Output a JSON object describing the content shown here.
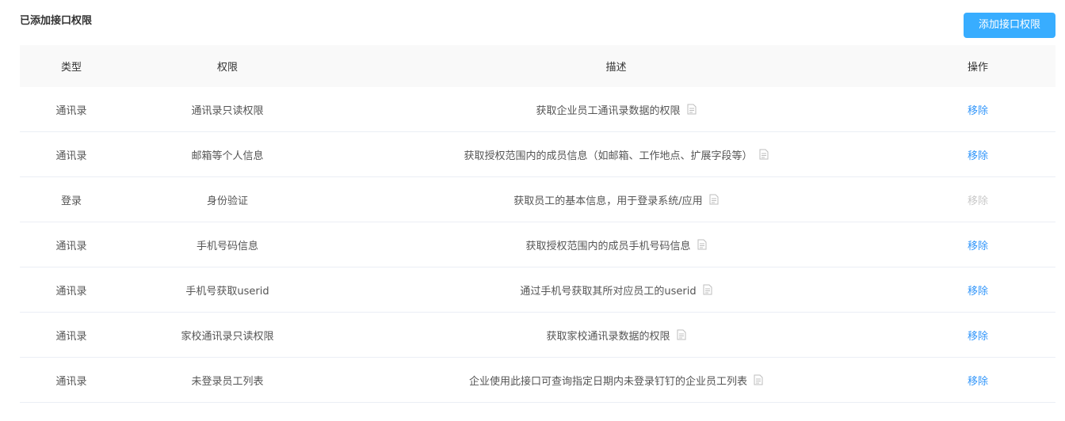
{
  "page": {
    "title": "已添加接口权限",
    "add_button_label": "添加接口权限"
  },
  "colors": {
    "accent": "#38adff",
    "link": "#3296fa",
    "link_disabled": "#c8c8c8",
    "header_bg": "#f9f9f9"
  },
  "table": {
    "columns": [
      "类型",
      "权限",
      "描述",
      "操作"
    ],
    "rows": [
      {
        "type": "通讯录",
        "permission": "通讯录只读权限",
        "description": "获取企业员工通讯录数据的权限",
        "action": "移除",
        "action_disabled": false,
        "icon": "document-icon"
      },
      {
        "type": "通讯录",
        "permission": "邮箱等个人信息",
        "description": "获取授权范围内的成员信息（如邮箱、工作地点、扩展字段等）",
        "action": "移除",
        "action_disabled": false,
        "icon": "document-icon"
      },
      {
        "type": "登录",
        "permission": "身份验证",
        "description": "获取员工的基本信息，用于登录系统/应用",
        "action": "移除",
        "action_disabled": true,
        "icon": "document-icon"
      },
      {
        "type": "通讯录",
        "permission": "手机号码信息",
        "description": "获取授权范围内的成员手机号码信息",
        "action": "移除",
        "action_disabled": false,
        "icon": "document-icon"
      },
      {
        "type": "通讯录",
        "permission": "手机号获取userid",
        "description": "通过手机号获取其所对应员工的userid",
        "action": "移除",
        "action_disabled": false,
        "icon": "document-icon"
      },
      {
        "type": "通讯录",
        "permission": "家校通讯录只读权限",
        "description": "获取家校通讯录数据的权限",
        "action": "移除",
        "action_disabled": false,
        "icon": "document-icon"
      },
      {
        "type": "通讯录",
        "permission": "未登录员工列表",
        "description": "企业使用此接口可查询指定日期内未登录钉钉的企业员工列表",
        "action": "移除",
        "action_disabled": false,
        "icon": "document-icon"
      }
    ]
  }
}
